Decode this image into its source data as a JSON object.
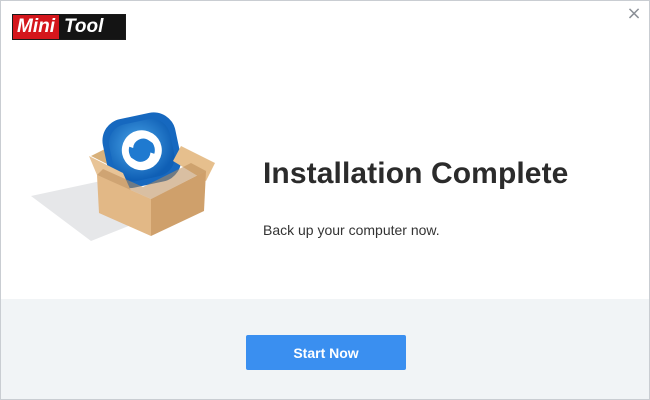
{
  "logo": {
    "part1": "Mini",
    "part2": "Tool"
  },
  "window": {
    "close_glyph": "×"
  },
  "main": {
    "title": "Installation Complete",
    "subtitle": "Back up your computer now."
  },
  "footer": {
    "start_label": "Start Now"
  },
  "colors": {
    "accent": "#3a8ff0",
    "logo_red": "#d4161c",
    "logo_black": "#141414",
    "footer_bg": "#f1f4f6"
  },
  "icons": {
    "close": "close-icon",
    "illustration": "software-box-icon"
  }
}
